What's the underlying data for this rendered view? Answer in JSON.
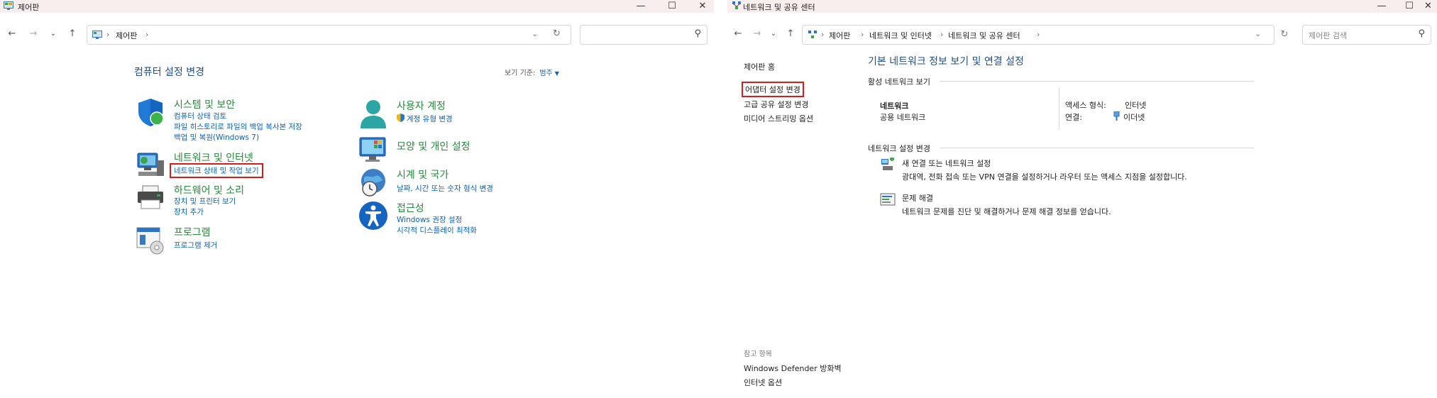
{
  "window1": {
    "title": "제어판",
    "breadcrumb": [
      "제어판"
    ],
    "search_placeholder": "",
    "page_heading": "컴퓨터 설정 변경",
    "view_by_label": "보기 기준:",
    "view_by_value": "범주",
    "categories_left": [
      {
        "icon": "shield-icon",
        "title": "시스템 및 보안",
        "links": [
          "컴퓨터 상태 검토",
          "파일 히스토리로 파일의 백업 복사본 저장",
          "백업 및 복원(Windows 7)"
        ]
      },
      {
        "icon": "network-icon",
        "title": "네트워크 및 인터넷",
        "links": [
          "네트워크 상태 및 작업 보기"
        ]
      },
      {
        "icon": "printer-icon",
        "title": "하드웨어 및 소리",
        "links": [
          "장치 및 프린터 보기",
          "장치 추가"
        ]
      },
      {
        "icon": "programs-icon",
        "title": "프로그램",
        "links": [
          "프로그램 제거"
        ]
      }
    ],
    "categories_right": [
      {
        "icon": "user-icon",
        "title": "사용자 계정",
        "links": [
          "계정 유형 변경"
        ]
      },
      {
        "icon": "personalization-icon",
        "title": "모양 및 개인 설정",
        "links": []
      },
      {
        "icon": "clock-globe-icon",
        "title": "시계 및 국가",
        "links": [
          "날짜, 시간 또는 숫자 형식 변경"
        ]
      },
      {
        "icon": "accessibility-icon",
        "title": "접근성",
        "links": [
          "Windows 권장 설정",
          "시각적 디스플레이 최적화"
        ]
      }
    ]
  },
  "window2": {
    "title": "네트워크 및 공유 센터",
    "breadcrumb": [
      "제어판",
      "네트워크 및 인터넷",
      "네트워크 및 공유 센터"
    ],
    "search_placeholder": "제어판 검색",
    "left_nav": [
      "제어판 홈",
      "어댑터 설정 변경",
      "고급 공유 설정 변경",
      "미디어 스트리밍 옵션"
    ],
    "see_also_header": "참고 항목",
    "see_also": [
      "Windows Defender 방화벽",
      "인터넷 옵션"
    ],
    "heading": "기본 네트워크 정보 보기 및 연결 설정",
    "active_networks_header": "활성 네트워크 보기",
    "network_name": "네트워크",
    "network_type": "공용 네트워크",
    "access_type_label": "액세스 형식:",
    "access_type_value": "인터넷",
    "connections_label": "연결:",
    "connections_value": "이더넷",
    "change_settings_header": "네트워크 설정 변경",
    "tasks": [
      {
        "icon": "new-connection-icon",
        "title": "새 연결 또는 네트워크 설정",
        "desc": "광대역, 전화 접속 또는 VPN 연결을 설정하거나 라우터 또는 액세스 지점을 설정합니다."
      },
      {
        "icon": "troubleshoot-icon",
        "title": "문제 해결",
        "desc": "네트워크 문제를 진단 및 해결하거나 문제 해결 정보를 얻습니다."
      }
    ]
  },
  "window_controls": {
    "minimize": "—",
    "maximize": "☐",
    "close": "✕"
  },
  "colors": {
    "link": "#0a63b9",
    "category_title": "#238b3a",
    "heading": "#1e4f8d",
    "highlight": "#d81b1b",
    "titlebar": "#f9eeee"
  }
}
